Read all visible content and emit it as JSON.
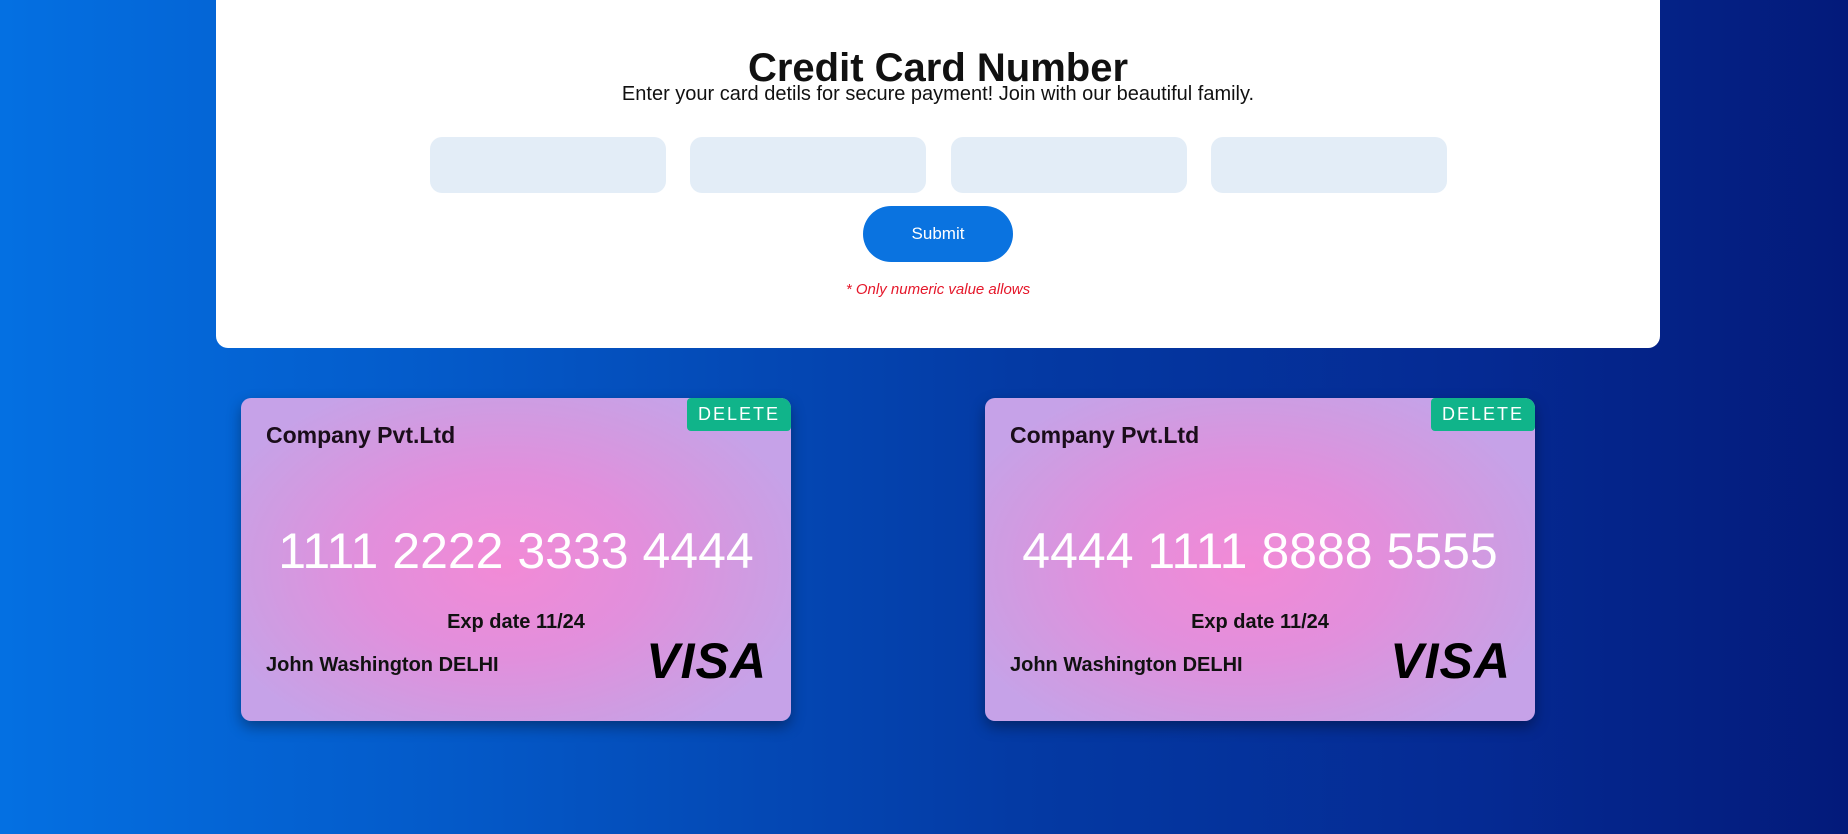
{
  "form": {
    "title": "Credit Card Number",
    "subtitle": "Enter your card detils for secure payment! Join with our beautiful family.",
    "inputs": [
      {
        "value": "",
        "placeholder": ""
      },
      {
        "value": "",
        "placeholder": ""
      },
      {
        "value": "",
        "placeholder": ""
      },
      {
        "value": "",
        "placeholder": ""
      }
    ],
    "submit_label": "Submit",
    "note": "* Only numeric value allows"
  },
  "cards": [
    {
      "company": "Company Pvt.Ltd",
      "delete_label": "DELETE",
      "number": "1111 2222 3333 4444",
      "exp": "Exp date 11/24",
      "holder": "John Washington DELHI",
      "brand": "VISA"
    },
    {
      "company": "Company Pvt.Ltd",
      "delete_label": "DELETE",
      "number": "4444 1111 8888 5555",
      "exp": "Exp date 11/24",
      "holder": "John Washington DELHI",
      "brand": "VISA"
    }
  ],
  "colors": {
    "accent": "#0a73e0",
    "delete": "#10b48a",
    "note": "#e5172a",
    "input_bg": "#e3edf7"
  }
}
